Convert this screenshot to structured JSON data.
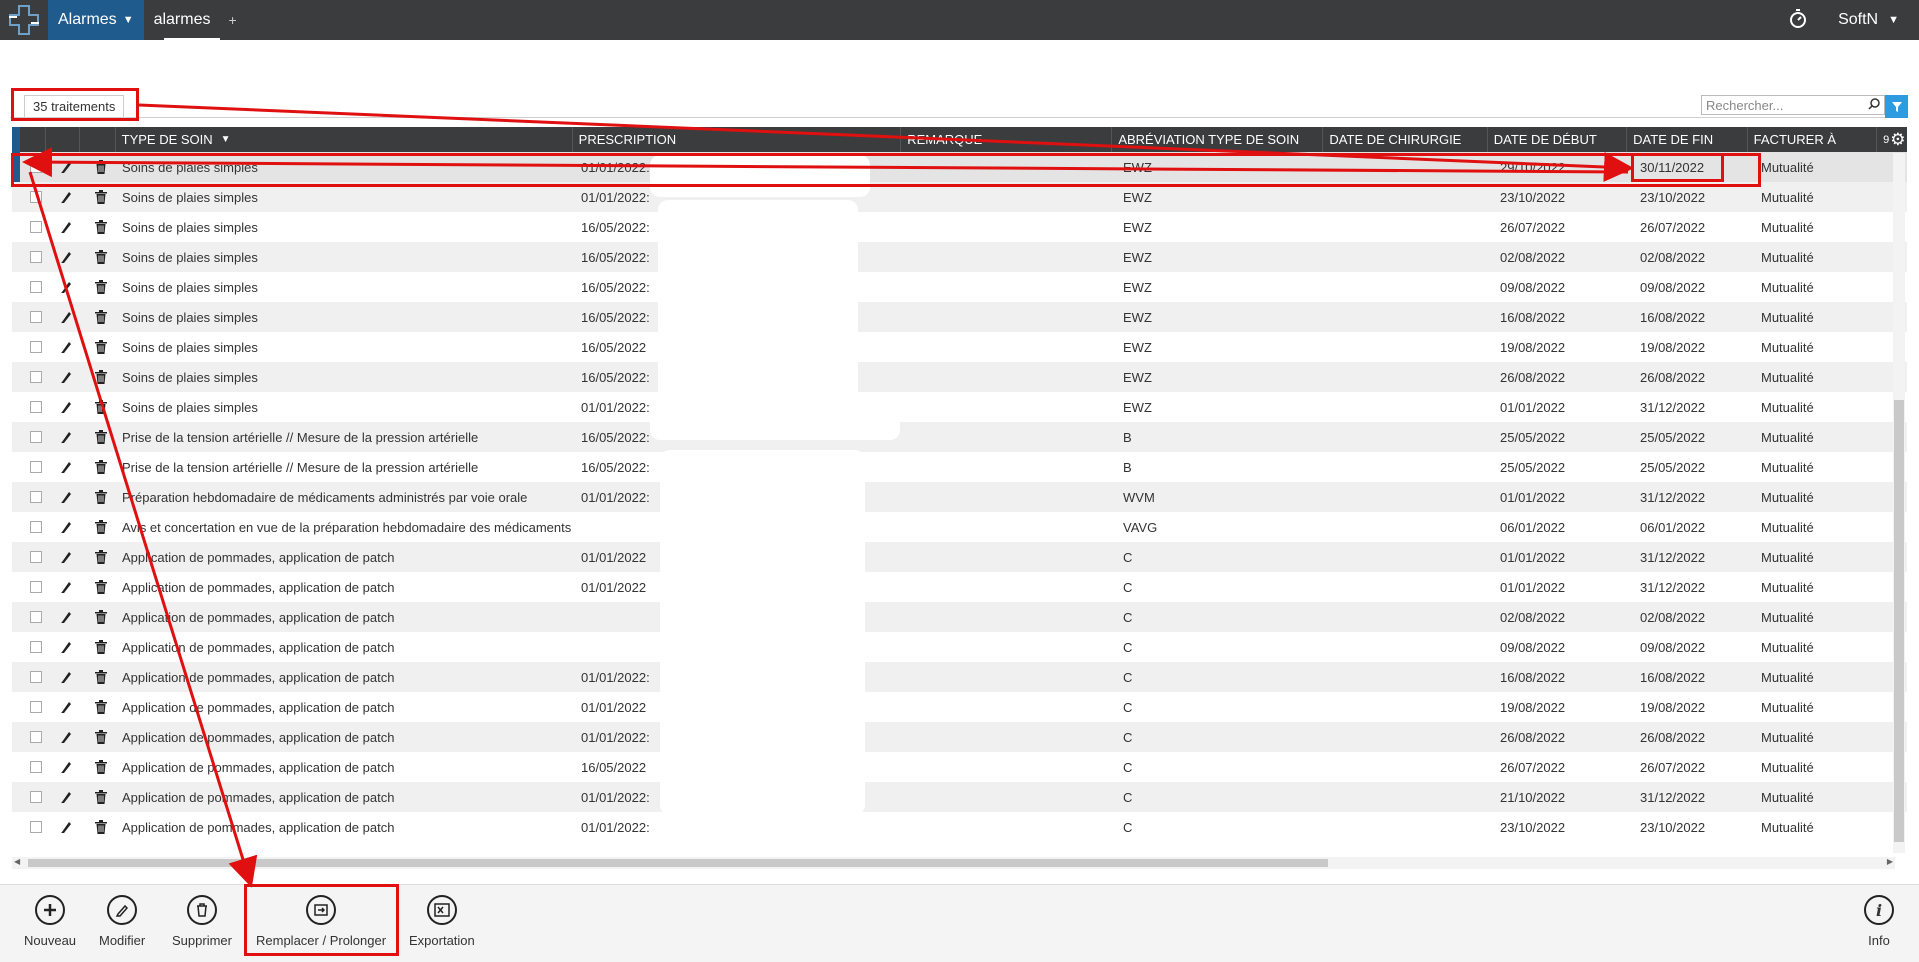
{
  "app": {
    "module_label": "Alarmes",
    "doc_tab": "alarmes",
    "add_tab": "+",
    "user": "SoftN"
  },
  "list": {
    "count_label": "35 traitements",
    "search_placeholder": "Rechercher..."
  },
  "columns": {
    "type": "TYPE DE SOIN",
    "prescription": "PRESCRIPTION",
    "remarque": "REMARQUE",
    "abbr": "ABRÉVIATION TYPE DE SOIN",
    "surgery": "DATE DE CHIRURGIE",
    "start": "DATE DE DÉBUT",
    "end": "DATE DE FIN",
    "bill": "FACTURER À",
    "more": "9"
  },
  "rows": [
    {
      "type": "Soins de plaies simples",
      "prescription": "01/01/2022:",
      "abbr": "EWZ",
      "start": "29/10/2022",
      "end": "30/11/2022",
      "bill": "Mutualité",
      "checked": true
    },
    {
      "type": "Soins de plaies simples",
      "prescription": "01/01/2022:",
      "abbr": "EWZ",
      "start": "23/10/2022",
      "end": "23/10/2022",
      "bill": "Mutualité",
      "checked": false
    },
    {
      "type": "Soins de plaies simples",
      "prescription": "16/05/2022:",
      "abbr": "EWZ",
      "start": "26/07/2022",
      "end": "26/07/2022",
      "bill": "Mutualité",
      "checked": false
    },
    {
      "type": "Soins de plaies simples",
      "prescription": "16/05/2022:",
      "abbr": "EWZ",
      "start": "02/08/2022",
      "end": "02/08/2022",
      "bill": "Mutualité",
      "checked": false
    },
    {
      "type": "Soins de plaies simples",
      "prescription": "16/05/2022:",
      "abbr": "EWZ",
      "start": "09/08/2022",
      "end": "09/08/2022",
      "bill": "Mutualité",
      "checked": false
    },
    {
      "type": "Soins de plaies simples",
      "prescription": "16/05/2022:",
      "abbr": "EWZ",
      "start": "16/08/2022",
      "end": "16/08/2022",
      "bill": "Mutualité",
      "checked": false
    },
    {
      "type": "Soins de plaies simples",
      "prescription": "16/05/2022",
      "abbr": "EWZ",
      "start": "19/08/2022",
      "end": "19/08/2022",
      "bill": "Mutualité",
      "checked": false
    },
    {
      "type": "Soins de plaies simples",
      "prescription": "16/05/2022:",
      "abbr": "EWZ",
      "start": "26/08/2022",
      "end": "26/08/2022",
      "bill": "Mutualité",
      "checked": false
    },
    {
      "type": "Soins de plaies simples",
      "prescription": "01/01/2022:",
      "abbr": "EWZ",
      "start": "01/01/2022",
      "end": "31/12/2022",
      "bill": "Mutualité",
      "checked": false
    },
    {
      "type": "Prise de la tension artérielle // Mesure de la pression artérielle",
      "prescription": "16/05/2022:",
      "abbr": "B",
      "start": "25/05/2022",
      "end": "25/05/2022",
      "bill": "Mutualité",
      "checked": false
    },
    {
      "type": "Prise de la tension artérielle // Mesure de la pression artérielle",
      "prescription": "16/05/2022:",
      "abbr": "B",
      "start": "25/05/2022",
      "end": "25/05/2022",
      "bill": "Mutualité",
      "checked": false
    },
    {
      "type": "Préparation hebdomadaire de médicaments administrés par voie orale",
      "prescription": "01/01/2022:",
      "abbr": "WVM",
      "start": "01/01/2022",
      "end": "31/12/2022",
      "bill": "Mutualité",
      "checked": false
    },
    {
      "type": "Avis et concertation en vue de la préparation hebdomadaire des médicaments",
      "prescription": "",
      "abbr": "VAVG",
      "start": "06/01/2022",
      "end": "06/01/2022",
      "bill": "Mutualité",
      "checked": false
    },
    {
      "type": "Application de pommades, application de patch",
      "prescription": "01/01/2022",
      "abbr": "C",
      "start": "01/01/2022",
      "end": "31/12/2022",
      "bill": "Mutualité",
      "checked": false
    },
    {
      "type": "Application de pommades, application de patch",
      "prescription": "01/01/2022",
      "abbr": "C",
      "start": "01/01/2022",
      "end": "31/12/2022",
      "bill": "Mutualité",
      "checked": false
    },
    {
      "type": "Application de pommades, application de patch",
      "prescription": "",
      "abbr": "C",
      "start": "02/08/2022",
      "end": "02/08/2022",
      "bill": "Mutualité",
      "checked": false
    },
    {
      "type": "Application de pommades, application de patch",
      "prescription": "",
      "abbr": "C",
      "start": "09/08/2022",
      "end": "09/08/2022",
      "bill": "Mutualité",
      "checked": false
    },
    {
      "type": "Application de pommades, application de patch",
      "prescription": "01/01/2022:",
      "abbr": "C",
      "start": "16/08/2022",
      "end": "16/08/2022",
      "bill": "Mutualité",
      "checked": false
    },
    {
      "type": "Application de pommades, application de patch",
      "prescription": "01/01/2022",
      "abbr": "C",
      "start": "19/08/2022",
      "end": "19/08/2022",
      "bill": "Mutualité",
      "checked": false
    },
    {
      "type": "Application de pommades, application de patch",
      "prescription": "01/01/2022:",
      "abbr": "C",
      "start": "26/08/2022",
      "end": "26/08/2022",
      "bill": "Mutualité",
      "checked": false
    },
    {
      "type": "Application de pommades, application de patch",
      "prescription": "16/05/2022",
      "abbr": "C",
      "start": "26/07/2022",
      "end": "26/07/2022",
      "bill": "Mutualité",
      "checked": false
    },
    {
      "type": "Application de pommades, application de patch",
      "prescription": "01/01/2022:",
      "abbr": "C",
      "start": "21/10/2022",
      "end": "31/12/2022",
      "bill": "Mutualité",
      "checked": false
    },
    {
      "type": "Application de pommades, application de patch",
      "prescription": "01/01/2022:",
      "abbr": "C",
      "start": "23/10/2022",
      "end": "23/10/2022",
      "bill": "Mutualité",
      "checked": false
    }
  ],
  "toolbar": {
    "new": "Nouveau",
    "edit": "Modifier",
    "delete": "Supprimer",
    "replace": "Remplacer / Prolonger",
    "export": "Exportation",
    "info": "Info"
  },
  "colors": {
    "topbar": "#3a3c3e",
    "module_blue": "#1f5b8c",
    "filter_blue": "#2d9be0",
    "annotation_red": "#e01010"
  }
}
